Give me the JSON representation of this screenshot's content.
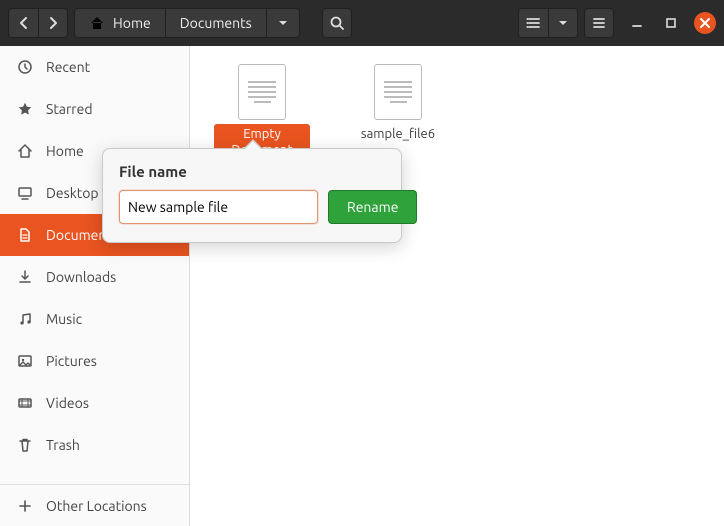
{
  "path": {
    "home": "Home",
    "current": "Documents"
  },
  "sidebar": {
    "items": [
      {
        "label": "Recent"
      },
      {
        "label": "Starred"
      },
      {
        "label": "Home"
      },
      {
        "label": "Desktop"
      },
      {
        "label": "Documents"
      },
      {
        "label": "Downloads"
      },
      {
        "label": "Music"
      },
      {
        "label": "Pictures"
      },
      {
        "label": "Videos"
      },
      {
        "label": "Trash"
      }
    ],
    "other": "Other Locations"
  },
  "files": [
    {
      "name": "Empty Document"
    },
    {
      "name": "sample_file6"
    }
  ],
  "rename": {
    "label": "File name",
    "value": "New sample file",
    "button": "Rename"
  }
}
